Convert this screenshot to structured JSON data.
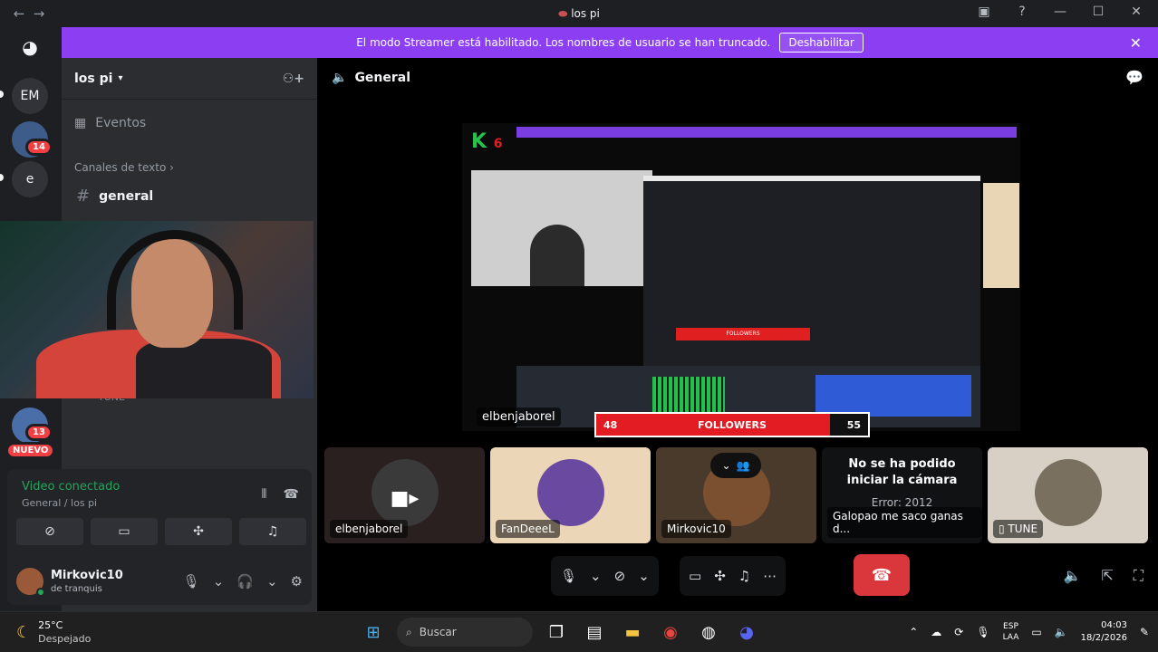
{
  "window": {
    "title": "los pi"
  },
  "banner": {
    "text": "El modo Streamer está habilitado. Los nombres de usuario se han truncado.",
    "button": "Deshabilitar"
  },
  "guilds": {
    "em_label": "EM",
    "e_label": "e",
    "badge_14": "14",
    "badge_13": "13",
    "nuevo": "NUEVO"
  },
  "server": {
    "name": "los pi",
    "events": "Eventos",
    "category": "Canales de texto",
    "channel": "general"
  },
  "under_webcam_label": "TUNE",
  "voice_panel": {
    "status": "Video conectado",
    "location": "General / los pi"
  },
  "user": {
    "name": "Mirkovic10",
    "status": "de tranquis"
  },
  "main": {
    "channel_title": "General",
    "stream_owner": "elbenjaborel",
    "followers": {
      "left": "48",
      "label": "FOLLOWERS",
      "right": "55",
      "fill": 0.86
    }
  },
  "tiles": [
    {
      "name": "elbenjaborel"
    },
    {
      "name": "FanDeeeL"
    },
    {
      "name": "Mirkovic10"
    },
    {
      "title": "No se ha podido iniciar la cámara",
      "error": "Error: 2012",
      "name": "Galopao me saco ganas d..."
    },
    {
      "name": "TUNE"
    }
  ],
  "taskbar": {
    "temp": "25°C",
    "weather": "Despejado",
    "search": "Buscar",
    "lang1": "ESP",
    "lang2": "LAA",
    "time": "04:03",
    "date": "18/2/2026"
  },
  "colors": {
    "banner": "#8b3ef2",
    "connected": "#23a55a",
    "hangup": "#da373c",
    "followers_bar": "#e31b23"
  }
}
